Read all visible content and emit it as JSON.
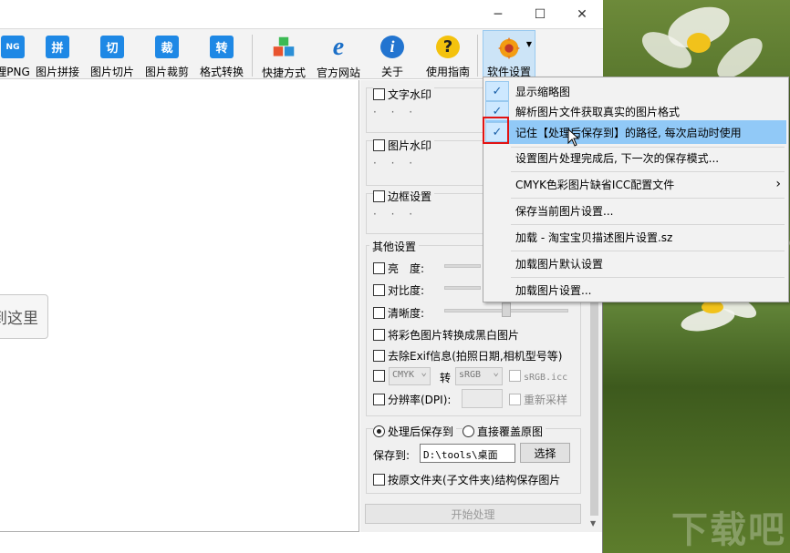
{
  "window": {
    "controls": {
      "minimize": "─",
      "maximize": "☐",
      "close": "✕"
    }
  },
  "toolbar": {
    "items": [
      {
        "icon_text": "NG",
        "label": "理PNG",
        "color": "#1e88e5"
      },
      {
        "icon_text": "拼",
        "label": "图片拼接",
        "color": "#1e88e5"
      },
      {
        "icon_text": "切",
        "label": "图片切片",
        "color": "#1e88e5"
      },
      {
        "icon_text": "裁",
        "label": "图片裁剪",
        "color": "#1e88e5"
      },
      {
        "icon_text": "转",
        "label": "格式转换",
        "color": "#1e88e5"
      },
      {
        "icon_text": "",
        "label": "快捷方式",
        "color": "#e8542f"
      },
      {
        "icon_text": "e",
        "label": "官方网站",
        "color": "#1b6fc7"
      },
      {
        "icon_text": "i",
        "label": "关于",
        "color": "#2274d0"
      },
      {
        "icon_text": "?",
        "label": "使用指南",
        "color": "#f4c20d"
      },
      {
        "icon_text": "",
        "label": "软件设置",
        "color": "#f39c12"
      }
    ]
  },
  "canvas": {
    "drop_text": "到这里"
  },
  "panel": {
    "text_watermark": "文字水印",
    "image_watermark": "图片水印",
    "border_settings": "边框设置",
    "placeholder_dots": "· · ·",
    "other_settings": "其他设置",
    "brightness": "亮　度:",
    "contrast": "对比度:",
    "sharpness": "清晰度:",
    "grayscale": "将彩色图片转换成黑白图片",
    "remove_exif": "去除Exif信息(拍照日期,相机型号等)",
    "cmyk_from": "CMYK",
    "convert_to": "转",
    "cmyk_to": "sRGB",
    "icc_file": "sRGB.icc",
    "resolution": "分辨率(DPI):",
    "resample": "重新采样",
    "save_after": "处理后保存到",
    "overwrite": "直接覆盖原图",
    "save_to_label": "保存到:",
    "save_path": "D:\\tools\\桌面",
    "choose_button": "选择",
    "keep_structure": "按原文件夹(子文件夹)结构保存图片",
    "start_button": "开始处理"
  },
  "menu": {
    "items": [
      {
        "label": "显示缩略图",
        "checked": true
      },
      {
        "label": "解析图片文件获取真实的图片格式",
        "checked": true
      },
      {
        "label": "记住【处理后保存到】的路径, 每次启动时使用",
        "checked": true,
        "highlighted": true
      },
      {
        "label": "设置图片处理完成后, 下一次的保存模式...",
        "checked": false
      },
      {
        "label": "CMYK色彩图片缺省ICC配置文件",
        "checked": false,
        "submenu": true
      },
      {
        "label": "保存当前图片设置...",
        "checked": false
      },
      {
        "label": "加载 - 淘宝宝贝描述图片设置.sz",
        "checked": false
      },
      {
        "label": "加载图片默认设置",
        "checked": false
      },
      {
        "label": "加载图片设置...",
        "checked": false
      }
    ],
    "check_glyph": "✓",
    "submenu_glyph": "›"
  },
  "wallpaper": {
    "watermark": "下载吧"
  }
}
